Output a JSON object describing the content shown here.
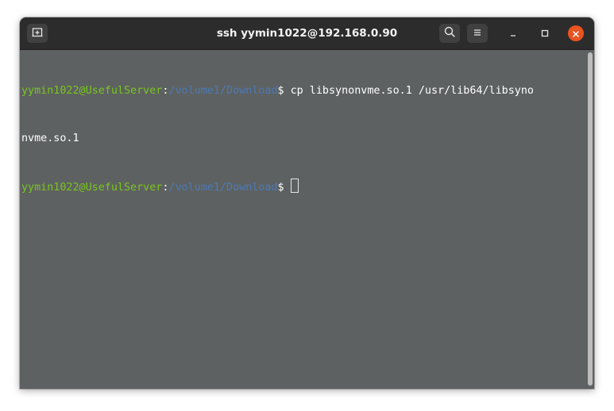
{
  "window": {
    "title": "ssh yymin1022@192.168.0.90"
  },
  "titlebar": {
    "new_tab_icon": "new-tab-icon",
    "search_icon": "search-icon",
    "menu_icon": "hamburger-menu-icon",
    "minimize_icon": "minimize-icon",
    "maximize_icon": "maximize-icon",
    "close_icon": "close-icon"
  },
  "terminal": {
    "prompt_user_host": "yymin1022@UsefulServer",
    "prompt_sep": ":",
    "prompt_path": "/volume1/Download",
    "prompt_symbol": "$ ",
    "command_line1": "cp libsynonvme.so.1 /usr/lib64/libsyno",
    "command_line2": "nvme.so.1"
  },
  "colors": {
    "terminal_bg": "#5e6161",
    "titlebar_bg": "#2c2c2c",
    "prompt_user": "#78c61e",
    "prompt_path": "#4a7ab5",
    "close_button": "#e95420"
  }
}
